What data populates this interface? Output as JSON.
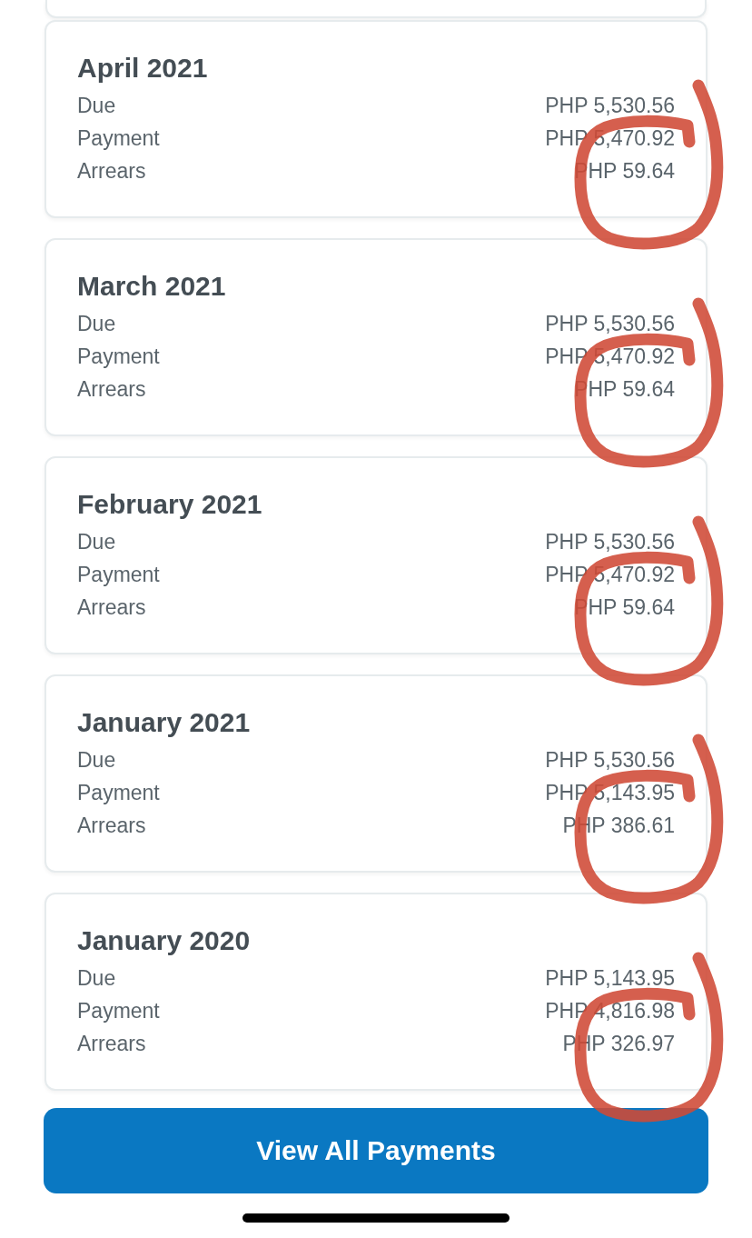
{
  "statements": [
    {
      "period": "April 2021",
      "circled": true,
      "rows": [
        {
          "label": "Due",
          "amount": "PHP 5,530.56"
        },
        {
          "label": "Payment",
          "amount": "PHP 5,470.92"
        },
        {
          "label": "Arrears",
          "amount": "PHP 59.64"
        }
      ]
    },
    {
      "period": "March 2021",
      "circled": true,
      "rows": [
        {
          "label": "Due",
          "amount": "PHP 5,530.56"
        },
        {
          "label": "Payment",
          "amount": "PHP 5,470.92"
        },
        {
          "label": "Arrears",
          "amount": "PHP 59.64"
        }
      ]
    },
    {
      "period": "February 2021",
      "circled": true,
      "rows": [
        {
          "label": "Due",
          "amount": "PHP 5,530.56"
        },
        {
          "label": "Payment",
          "amount": "PHP 5,470.92"
        },
        {
          "label": "Arrears",
          "amount": "PHP 59.64"
        }
      ]
    },
    {
      "period": "January 2021",
      "circled": true,
      "rows": [
        {
          "label": "Due",
          "amount": "PHP 5,530.56"
        },
        {
          "label": "Payment",
          "amount": "PHP 5,143.95"
        },
        {
          "label": "Arrears",
          "amount": "PHP 386.61"
        }
      ]
    },
    {
      "period": "January 2020",
      "circled": true,
      "rows": [
        {
          "label": "Due",
          "amount": "PHP 5,143.95"
        },
        {
          "label": "Payment",
          "amount": "PHP 4,816.98"
        },
        {
          "label": "Arrears",
          "amount": "PHP 326.97"
        }
      ]
    }
  ],
  "view_all_button": {
    "label": "View All Payments"
  }
}
